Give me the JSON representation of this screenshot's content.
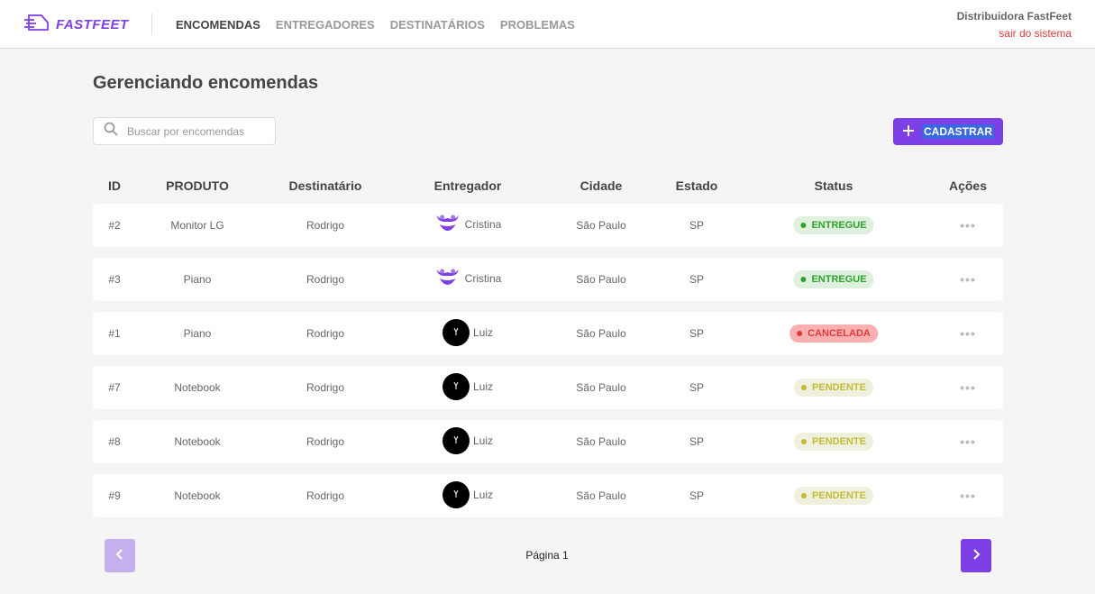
{
  "header": {
    "logo_text": "FASTFEET",
    "nav": [
      "ENCOMENDAS",
      "ENTREGADORES",
      "DESTINATÁRIOS",
      "PROBLEMAS"
    ],
    "user_name": "Distribuidora FastFeet",
    "logout_label": "sair do sistema"
  },
  "page": {
    "title": "Gerenciando encomendas"
  },
  "search": {
    "placeholder": "Buscar por encomendas",
    "icon": "search-icon"
  },
  "add_button": {
    "label": "CADASTRAR",
    "icon": "plus-icon"
  },
  "table": {
    "columns": [
      "ID",
      "PRODUTO",
      "Destinatário",
      "Entregador",
      "Cidade",
      "Estado",
      "Status",
      "Ações"
    ],
    "rows": [
      {
        "id": "#2",
        "product": "Monitor LG",
        "recipient": "Rodrigo",
        "deliveryman": "Cristina",
        "avatar": "purple-face-icon",
        "city": "São Paulo",
        "state": "SP",
        "status": "ENTREGUE",
        "status_type": "delivered",
        "actions": "•••"
      },
      {
        "id": "#3",
        "product": "Piano",
        "recipient": "Rodrigo",
        "deliveryman": "Cristina",
        "avatar": "purple-face-icon",
        "city": "São Paulo",
        "state": "SP",
        "status": "ENTREGUE",
        "status_type": "delivered",
        "actions": "•••"
      },
      {
        "id": "#1",
        "product": "Piano",
        "recipient": "Rodrigo",
        "deliveryman": "Luiz",
        "avatar": "dark-photo-icon",
        "city": "São Paulo",
        "state": "SP",
        "status": "CANCELADA",
        "status_type": "canceled",
        "actions": "•••"
      },
      {
        "id": "#7",
        "product": "Notebook",
        "recipient": "Rodrigo",
        "deliveryman": "Luiz",
        "avatar": "dark-photo-icon",
        "city": "São Paulo",
        "state": "SP",
        "status": "PENDENTE",
        "status_type": "pending",
        "actions": "•••"
      },
      {
        "id": "#8",
        "product": "Notebook",
        "recipient": "Rodrigo",
        "deliveryman": "Luiz",
        "avatar": "dark-photo-icon",
        "city": "São Paulo",
        "state": "SP",
        "status": "PENDENTE",
        "status_type": "pending",
        "actions": "•••"
      },
      {
        "id": "#9",
        "product": "Notebook",
        "recipient": "Rodrigo",
        "deliveryman": "Luiz",
        "avatar": "dark-photo-icon",
        "city": "São Paulo",
        "state": "SP",
        "status": "PENDENTE",
        "status_type": "pending",
        "actions": "•••"
      }
    ]
  },
  "status_colors": {
    "delivered": {
      "bg": "#dff0df",
      "fg": "#2ca42b"
    },
    "canceled": {
      "bg": "#fab0b0",
      "fg": "#de3b3b"
    },
    "pending": {
      "bg": "#f0f0df",
      "fg": "#c1bc35"
    }
  },
  "pagination": {
    "label": "Página 1",
    "prev_icon": "chevron-left-icon",
    "next_icon": "chevron-right-icon"
  },
  "colors": {
    "brand": "#7d40e7",
    "logout": "#de3b3b"
  }
}
